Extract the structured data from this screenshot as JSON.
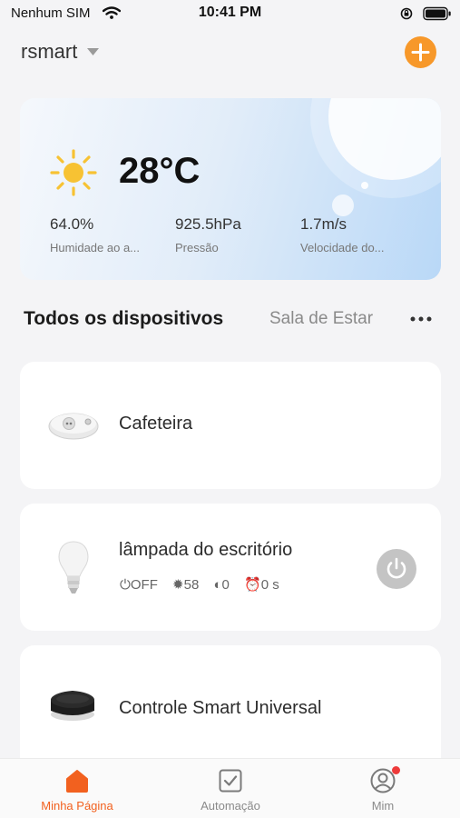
{
  "status_bar": {
    "carrier": "Nenhum SIM",
    "time": "10:41 PM"
  },
  "header": {
    "home_name": "rsmart",
    "add_icon": "plus-icon",
    "accent_color": "#f7982a"
  },
  "weather": {
    "temperature": "28°C",
    "icon": "sun-icon",
    "stats": [
      {
        "value": "64.0%",
        "label": "Humidade ao a..."
      },
      {
        "value": "925.5hPa",
        "label": "Pressão"
      },
      {
        "value": "1.7m/s",
        "label": "Velocidade do..."
      }
    ]
  },
  "devices_section": {
    "title": "Todos os dispositivos",
    "room_tab": "Sala de Estar",
    "more_icon": "more-dots-icon"
  },
  "devices": [
    {
      "name": "Cafeteira",
      "icon": "smart-plug-icon"
    },
    {
      "name": "lâmpada do escritório",
      "icon": "light-bulb-icon",
      "status": {
        "power": "OFF",
        "brightness": "58",
        "color_temp": "0",
        "timer": "0 s"
      },
      "power_state": "off"
    },
    {
      "name": "Controle Smart Universal",
      "icon": "ir-remote-hub-icon"
    }
  ],
  "tab_bar": {
    "active_color": "#f2611f",
    "tabs": [
      {
        "label": "Minha Página",
        "icon": "home-icon",
        "active": true
      },
      {
        "label": "Automação",
        "icon": "checkbox-icon",
        "active": false
      },
      {
        "label": "Mim",
        "icon": "profile-icon",
        "active": false,
        "notification": true
      }
    ]
  }
}
